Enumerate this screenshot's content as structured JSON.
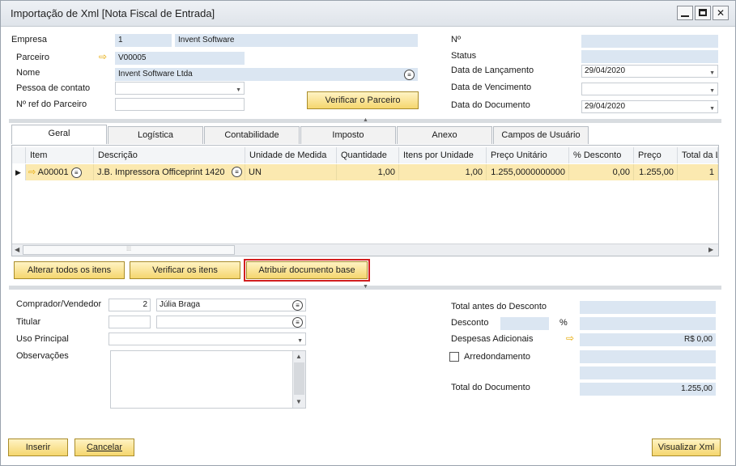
{
  "window": {
    "title": "Importação de Xml [Nota Fiscal de Entrada]",
    "minimize": "–",
    "maximize": "□",
    "close": "✕"
  },
  "header_left": {
    "empresa_label": "Empresa",
    "empresa_code": "1",
    "empresa_name": "Invent Software",
    "parceiro_label": "Parceiro",
    "parceiro_value": "V00005",
    "nome_label": "Nome",
    "nome_value": "Invent Software Ltda",
    "pessoa_label": "Pessoa de contato",
    "pessoa_value": "",
    "nref_label": "Nº ref do Parceiro",
    "nref_value": "",
    "verificar_parceiro": "Verificar o Parceiro"
  },
  "header_right": {
    "no_label": "Nº",
    "no_value": "",
    "status_label": "Status",
    "status_value": "",
    "lancamento_label": "Data de Lançamento",
    "lancamento_value": "29/04/2020",
    "vencimento_label": "Data de Vencimento",
    "vencimento_value": "",
    "documento_label": "Data do Documento",
    "documento_value": "29/04/2020"
  },
  "tabs": [
    "Geral",
    "Logística",
    "Contabilidade",
    "Imposto",
    "Anexo",
    "Campos de Usuário"
  ],
  "grid": {
    "columns": [
      "Item",
      "Descrição",
      "Unidade de Medida",
      "Quantidade",
      "Itens por Unidade",
      "Preço Unitário",
      "% Desconto",
      "Preço",
      "Total da L"
    ],
    "row": {
      "item": "A00001",
      "descricao": "J.B. Impressora Officeprint 1420",
      "unidade": "UN",
      "quantidade": "1,00",
      "itens_unidade": "1,00",
      "preco_unitario": "1.255,0000000000",
      "desconto": "0,00",
      "preco": "1.255,00",
      "total": "1"
    }
  },
  "grid_buttons": {
    "alterar": "Alterar todos os itens",
    "verificar": "Verificar os itens",
    "atribuir": "Atribuir documento base"
  },
  "footer_left": {
    "comprador_label": "Comprador/Vendedor",
    "comprador_code": "2",
    "comprador_name": "Júlia Braga",
    "titular_label": "Titular",
    "titular_code": "",
    "titular_name": "",
    "uso_label": "Uso Principal",
    "uso_value": "",
    "obs_label": "Observações",
    "obs_value": ""
  },
  "footer_right": {
    "total_antes_label": "Total antes do Desconto",
    "total_antes_value": "",
    "desconto_label": "Desconto",
    "desconto_pct": "",
    "pct_sign": "%",
    "desconto_value": "",
    "despesas_label": "Despesas Adicionais",
    "despesas_value": "R$ 0,00",
    "arredondamento_label": "Arredondamento",
    "arredondamento_value": "",
    "extra_value": "",
    "total_doc_label": "Total do Documento",
    "total_doc_value": "1.255,00"
  },
  "bottom_buttons": {
    "inserir": "Inserir",
    "cancelar": "Cancelar",
    "visualizar": "Visualizar Xml"
  }
}
